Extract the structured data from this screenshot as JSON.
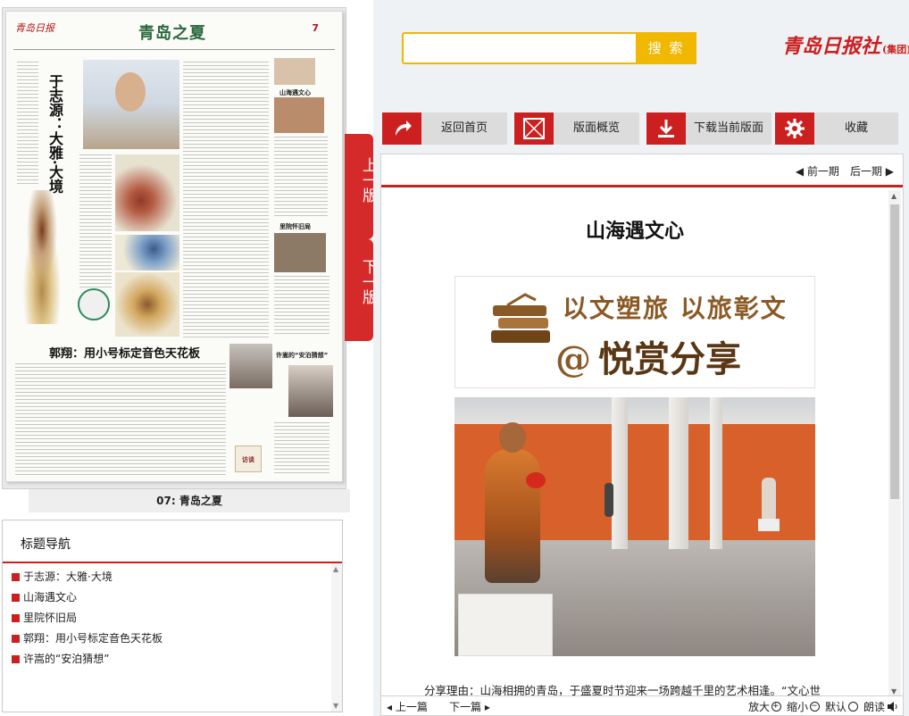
{
  "newspaper": {
    "masthead": "青岛日报",
    "section": "青岛之夏",
    "page_number": "7",
    "headline_main": "于志源：大雅·大境",
    "headline_second": "郭翔：用小号标定音色天花板",
    "subhead_1": "山海遇文心",
    "subhead_2": "里院怀旧局",
    "subhead_3": "许嵩的“安泊猜想”",
    "interview_badge": "访谈"
  },
  "flip": {
    "prev": "上一版",
    "next": "下一版"
  },
  "page_caption": "07: 青岛之夏",
  "headline_nav": {
    "title": "标题导航",
    "items": [
      "于志源：大雅·大境",
      "山海遇文心",
      "里院怀旧局",
      "郭翔：用小号标定音色天花板",
      "许嵩的“安泊猜想”"
    ]
  },
  "search": {
    "value": "",
    "button": "搜 索"
  },
  "brand": {
    "name": "青岛日报社",
    "suffix": "(集团)"
  },
  "toolbar": {
    "home": "返回首页",
    "overview": "版面概览",
    "download": "下载当前版面",
    "favorite": "收藏"
  },
  "issue_nav": {
    "prev": "前一期",
    "next": "后一期"
  },
  "article": {
    "title": "山海遇文心",
    "banner_line1": "以文塑旅  以旅彰文",
    "banner_line2_at": "@",
    "banner_line2": "悦赏分享",
    "share_text": "分享理由：山海相拥的青岛，于盛夏时节迎来一场跨越千里的艺术相逢。“文心世"
  },
  "bottom": {
    "prev_article": "上一篇",
    "next_article": "下一篇",
    "zoom_in": "放大",
    "zoom_out": "缩小",
    "default": "默认",
    "read_aloud": "朗读"
  },
  "colors": {
    "accent_red": "#cc2020",
    "search_yellow": "#f0b800"
  }
}
